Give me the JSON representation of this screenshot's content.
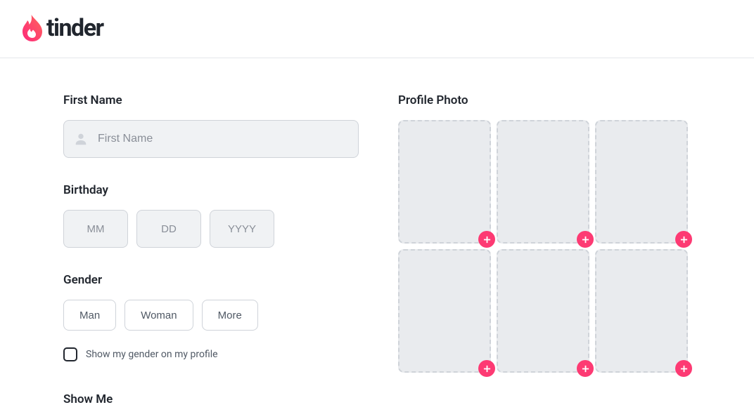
{
  "brand": {
    "name": "tinder"
  },
  "form": {
    "firstName": {
      "label": "First Name",
      "placeholder": "First Name",
      "value": ""
    },
    "birthday": {
      "label": "Birthday",
      "mm": {
        "placeholder": "MM",
        "value": ""
      },
      "dd": {
        "placeholder": "DD",
        "value": ""
      },
      "yyyy": {
        "placeholder": "YYYY",
        "value": ""
      }
    },
    "gender": {
      "label": "Gender",
      "options": [
        "Man",
        "Woman",
        "More"
      ],
      "showOnProfileLabel": "Show my gender on my profile"
    },
    "showMe": {
      "label": "Show Me"
    }
  },
  "photos": {
    "label": "Profile Photo",
    "slotCount": 6
  },
  "colors": {
    "accent": "#fd3a73",
    "flameStart": "#fd297b",
    "flameEnd": "#ff655b"
  }
}
